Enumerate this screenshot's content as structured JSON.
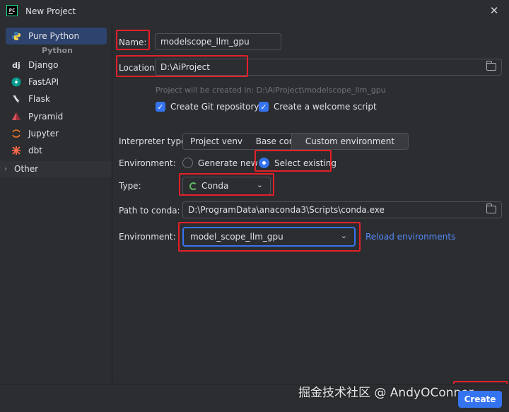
{
  "window": {
    "title": "New Project",
    "logo_text": "PC"
  },
  "sidebar": {
    "items": [
      {
        "label": "Pure Python",
        "icon": "python-icon"
      },
      {
        "label": "Django",
        "icon": "django-icon"
      },
      {
        "label": "FastAPI",
        "icon": "fastapi-icon"
      },
      {
        "label": "Flask",
        "icon": "flask-icon"
      },
      {
        "label": "Pyramid",
        "icon": "pyramid-icon"
      },
      {
        "label": "Jupyter",
        "icon": "jupyter-icon"
      },
      {
        "label": "dbt",
        "icon": "dbt-icon"
      }
    ],
    "group_label": "Python",
    "other_label": "Other"
  },
  "form": {
    "name_label": "Name:",
    "name_value": "modelscope_llm_gpu",
    "location_label": "Location:",
    "location_value": "D:\\AiProject",
    "location_hint": "Project will be created in: D:\\AiProject\\modelscope_llm_gpu",
    "git_label": "Create Git repository",
    "welcome_label": "Create a welcome script",
    "interpreter_label": "Interpreter type:",
    "interpreter_options": [
      "Project venv",
      "Base conda",
      "Custom environment"
    ],
    "interpreter_selected": "Custom environment",
    "environment_label": "Environment:",
    "generate_new_label": "Generate new",
    "select_existing_label": "Select existing",
    "type_label": "Type:",
    "type_value": "Conda",
    "conda_path_label": "Path to conda:",
    "conda_path_value": "D:\\ProgramData\\anaconda3\\Scripts\\conda.exe",
    "env_label": "Environment:",
    "env_value": "model_scope_llm_gpu",
    "reload_label": "Reload environments"
  },
  "footer": {
    "create_label": "Create",
    "watermark": "掘金技术社区 @ AndyOConnor"
  },
  "colors": {
    "accent": "#3574f0",
    "highlight": "#e3202a",
    "background": "#2b2d30"
  }
}
